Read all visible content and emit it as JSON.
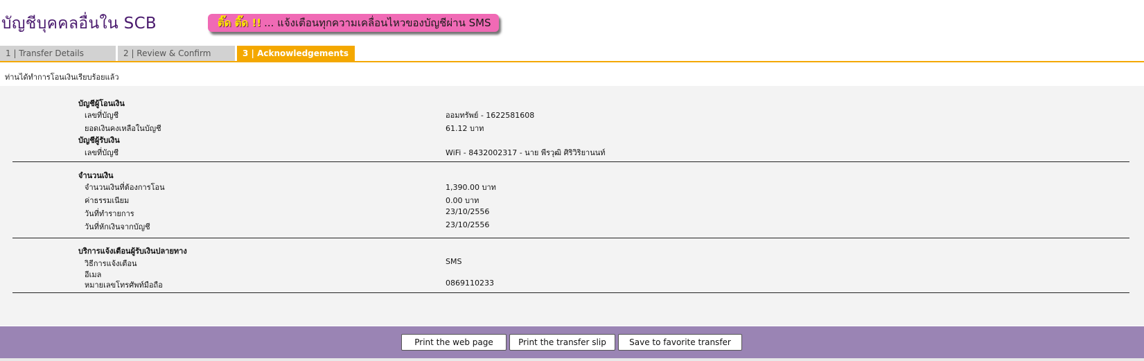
{
  "header": {
    "title": "บัญชีบุคคลอื่นใน SCB",
    "sms_banner": {
      "highlight": "ติ๊ด ติ๊ด !!",
      "text": "... แจ้งเตือนทุกความเคลื่อนไหวของบัญชีผ่าน SMS"
    }
  },
  "tabs": [
    {
      "label": "1 | Transfer Details",
      "active": false
    },
    {
      "label": "2 | Review & Confirm",
      "active": false
    },
    {
      "label": "3 | Acknowledgements",
      "active": true
    }
  ],
  "success_message": "ท่านได้ทำการโอนเงินเรียบร้อยแล้ว",
  "from_account": {
    "heading": "บัญชีผู้โอนเงิน",
    "account_label": "เลขที่บัญชี",
    "account_value": "ออมทรัพย์ - 1622581608",
    "balance_label": "ยอดเงินคงเหลือในบัญชี",
    "balance_value": "61.12 บาท"
  },
  "to_account": {
    "heading": "บัญชีผู้รับเงิน",
    "account_label": "เลขที่บัญชี",
    "account_value": "WiFi - 8432002317 - นาย พีรวุฒิ ศิริวิริยานนท์"
  },
  "amount": {
    "heading": "จำนวนเงิน",
    "transfer_label": "จำนวนเงินที่ต้องการโอน",
    "transfer_value": "1,390.00 บาท",
    "fee_label": "ค่าธรรมเนียม",
    "fee_value": "0.00  บาท",
    "txn_date_label": "วันที่ทำรายการ",
    "txn_date_value": "23/10/2556",
    "debit_date_label": "วันที่หักเงินจากบัญชี",
    "debit_date_value": "23/10/2556"
  },
  "notify": {
    "heading": "บริการแจ้งเตือนผู้รับเงินปลายทาง",
    "method_label": "วิธีการแจ้งเตือน",
    "method_value": "SMS",
    "email_label": "อีเมล",
    "phone_label": "หมายเลขโทรศัพท์มือถือ",
    "phone_value": "0869110233"
  },
  "actions": {
    "print_page": "Print the web page",
    "print_slip": "Print the transfer slip",
    "save_favorite": "Save to favorite transfer"
  },
  "colors": {
    "active_tab": "#f4a800",
    "inactive_tab": "#d2d2d2",
    "title": "#4a1a6e",
    "banner": "#f06ab5",
    "action_bar": "#9a84b4",
    "panel": "#f3f3f3"
  }
}
